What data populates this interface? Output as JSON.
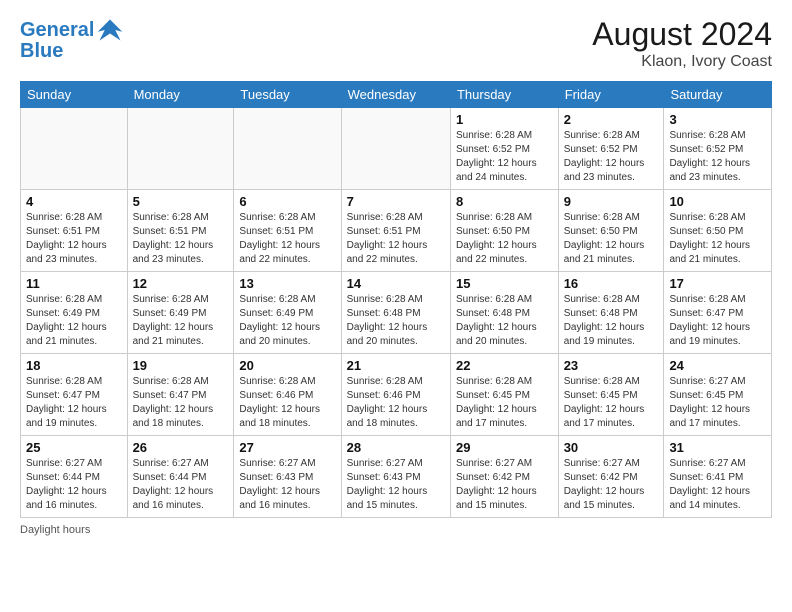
{
  "header": {
    "logo_line1": "General",
    "logo_line2": "Blue",
    "month_year": "August 2024",
    "location": "Klaon, Ivory Coast"
  },
  "footer": {
    "daylight_label": "Daylight hours"
  },
  "weekdays": [
    "Sunday",
    "Monday",
    "Tuesday",
    "Wednesday",
    "Thursday",
    "Friday",
    "Saturday"
  ],
  "weeks": [
    [
      {
        "day": "",
        "info": ""
      },
      {
        "day": "",
        "info": ""
      },
      {
        "day": "",
        "info": ""
      },
      {
        "day": "",
        "info": ""
      },
      {
        "day": "1",
        "info": "Sunrise: 6:28 AM\nSunset: 6:52 PM\nDaylight: 12 hours and 24 minutes."
      },
      {
        "day": "2",
        "info": "Sunrise: 6:28 AM\nSunset: 6:52 PM\nDaylight: 12 hours and 23 minutes."
      },
      {
        "day": "3",
        "info": "Sunrise: 6:28 AM\nSunset: 6:52 PM\nDaylight: 12 hours and 23 minutes."
      }
    ],
    [
      {
        "day": "4",
        "info": "Sunrise: 6:28 AM\nSunset: 6:51 PM\nDaylight: 12 hours and 23 minutes."
      },
      {
        "day": "5",
        "info": "Sunrise: 6:28 AM\nSunset: 6:51 PM\nDaylight: 12 hours and 23 minutes."
      },
      {
        "day": "6",
        "info": "Sunrise: 6:28 AM\nSunset: 6:51 PM\nDaylight: 12 hours and 22 minutes."
      },
      {
        "day": "7",
        "info": "Sunrise: 6:28 AM\nSunset: 6:51 PM\nDaylight: 12 hours and 22 minutes."
      },
      {
        "day": "8",
        "info": "Sunrise: 6:28 AM\nSunset: 6:50 PM\nDaylight: 12 hours and 22 minutes."
      },
      {
        "day": "9",
        "info": "Sunrise: 6:28 AM\nSunset: 6:50 PM\nDaylight: 12 hours and 21 minutes."
      },
      {
        "day": "10",
        "info": "Sunrise: 6:28 AM\nSunset: 6:50 PM\nDaylight: 12 hours and 21 minutes."
      }
    ],
    [
      {
        "day": "11",
        "info": "Sunrise: 6:28 AM\nSunset: 6:49 PM\nDaylight: 12 hours and 21 minutes."
      },
      {
        "day": "12",
        "info": "Sunrise: 6:28 AM\nSunset: 6:49 PM\nDaylight: 12 hours and 21 minutes."
      },
      {
        "day": "13",
        "info": "Sunrise: 6:28 AM\nSunset: 6:49 PM\nDaylight: 12 hours and 20 minutes."
      },
      {
        "day": "14",
        "info": "Sunrise: 6:28 AM\nSunset: 6:48 PM\nDaylight: 12 hours and 20 minutes."
      },
      {
        "day": "15",
        "info": "Sunrise: 6:28 AM\nSunset: 6:48 PM\nDaylight: 12 hours and 20 minutes."
      },
      {
        "day": "16",
        "info": "Sunrise: 6:28 AM\nSunset: 6:48 PM\nDaylight: 12 hours and 19 minutes."
      },
      {
        "day": "17",
        "info": "Sunrise: 6:28 AM\nSunset: 6:47 PM\nDaylight: 12 hours and 19 minutes."
      }
    ],
    [
      {
        "day": "18",
        "info": "Sunrise: 6:28 AM\nSunset: 6:47 PM\nDaylight: 12 hours and 19 minutes."
      },
      {
        "day": "19",
        "info": "Sunrise: 6:28 AM\nSunset: 6:47 PM\nDaylight: 12 hours and 18 minutes."
      },
      {
        "day": "20",
        "info": "Sunrise: 6:28 AM\nSunset: 6:46 PM\nDaylight: 12 hours and 18 minutes."
      },
      {
        "day": "21",
        "info": "Sunrise: 6:28 AM\nSunset: 6:46 PM\nDaylight: 12 hours and 18 minutes."
      },
      {
        "day": "22",
        "info": "Sunrise: 6:28 AM\nSunset: 6:45 PM\nDaylight: 12 hours and 17 minutes."
      },
      {
        "day": "23",
        "info": "Sunrise: 6:28 AM\nSunset: 6:45 PM\nDaylight: 12 hours and 17 minutes."
      },
      {
        "day": "24",
        "info": "Sunrise: 6:27 AM\nSunset: 6:45 PM\nDaylight: 12 hours and 17 minutes."
      }
    ],
    [
      {
        "day": "25",
        "info": "Sunrise: 6:27 AM\nSunset: 6:44 PM\nDaylight: 12 hours and 16 minutes."
      },
      {
        "day": "26",
        "info": "Sunrise: 6:27 AM\nSunset: 6:44 PM\nDaylight: 12 hours and 16 minutes."
      },
      {
        "day": "27",
        "info": "Sunrise: 6:27 AM\nSunset: 6:43 PM\nDaylight: 12 hours and 16 minutes."
      },
      {
        "day": "28",
        "info": "Sunrise: 6:27 AM\nSunset: 6:43 PM\nDaylight: 12 hours and 15 minutes."
      },
      {
        "day": "29",
        "info": "Sunrise: 6:27 AM\nSunset: 6:42 PM\nDaylight: 12 hours and 15 minutes."
      },
      {
        "day": "30",
        "info": "Sunrise: 6:27 AM\nSunset: 6:42 PM\nDaylight: 12 hours and 15 minutes."
      },
      {
        "day": "31",
        "info": "Sunrise: 6:27 AM\nSunset: 6:41 PM\nDaylight: 12 hours and 14 minutes."
      }
    ]
  ]
}
